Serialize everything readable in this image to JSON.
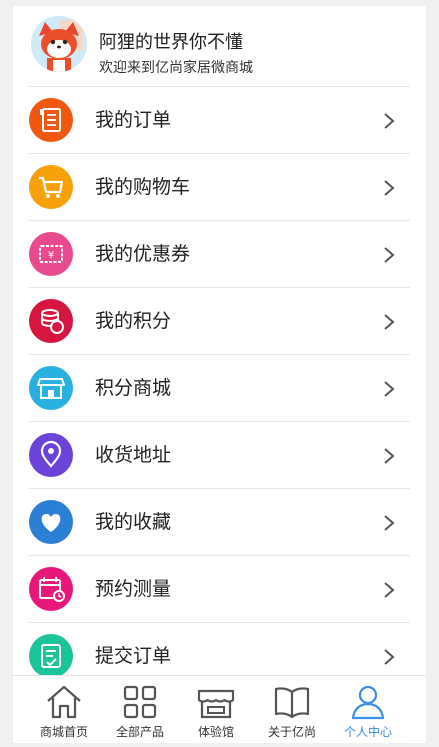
{
  "profile": {
    "name": "阿狸的世界你不懂",
    "welcome": "欢迎来到亿尚家居微商城"
  },
  "menu": [
    {
      "label": "我的订单",
      "icon": "order-list-icon",
      "color": "#f0570f"
    },
    {
      "label": "我的购物车",
      "icon": "cart-icon",
      "color": "#f6a00a"
    },
    {
      "label": "我的优惠券",
      "icon": "coupon-icon",
      "color": "#e84a8f"
    },
    {
      "label": "我的积分",
      "icon": "points-coins-icon",
      "color": "#d6163f"
    },
    {
      "label": "积分商城",
      "icon": "store-icon",
      "color": "#27b0e0"
    },
    {
      "label": "收货地址",
      "icon": "location-pin-icon",
      "color": "#6b43d8"
    },
    {
      "label": "我的收藏",
      "icon": "heart-icon",
      "color": "#2b7fd4"
    },
    {
      "label": "预约测量",
      "icon": "calendar-clock-icon",
      "color": "#e8187a"
    },
    {
      "label": "提交订单",
      "icon": "submit-order-icon",
      "color": "#1cc49a"
    }
  ],
  "tabbar": {
    "items": [
      {
        "label": "商城首页",
        "icon": "home-icon"
      },
      {
        "label": "全部产品",
        "icon": "grid-icon"
      },
      {
        "label": "体验馆",
        "icon": "shop-icon"
      },
      {
        "label": "关于亿尚",
        "icon": "book-icon"
      },
      {
        "label": "个人中心",
        "icon": "user-icon"
      }
    ],
    "active_color": "#3a8ee6"
  }
}
